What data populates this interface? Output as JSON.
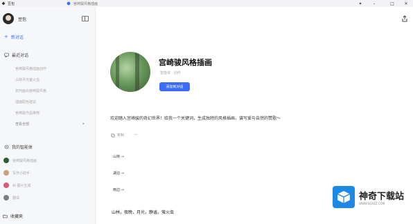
{
  "titlebar": {
    "app_title": "豆包",
    "tab_text": "宫崎骏风格插画"
  },
  "sidebar": {
    "user_name": "豆包",
    "new_chat": "新对话",
    "recent_header": "最近对话",
    "recent_items": [
      "宫崎骏风格插画创作",
      "山林月光萤火虫",
      "如何画出宫崎骏风格",
      "插画配色建议",
      "宫崎骏作品推荐"
    ],
    "more_label": "查看全部",
    "agents_header": "我的智能体",
    "agents": [
      {
        "label": "宫崎骏风格插画",
        "color": "#2f5d3a"
      },
      {
        "label": "写作小助手",
        "color": "#c9a27c"
      },
      {
        "label": "AI 图片生成",
        "color": "#d85c7a"
      },
      {
        "label": "翻译",
        "color": "#7d7d85"
      }
    ],
    "favorites": "收藏夹"
  },
  "bot": {
    "title": "宫崎骏风格插画",
    "meta": "智能体 · 创作",
    "add_button": "添加到对话"
  },
  "chat": {
    "welcome": "欢迎踏入宫崎骏的奇幻世界！给我一个关键词，生成独特的风格插画，谱写爱与自然的赞歌～",
    "action_label": "复制",
    "suggestions": [
      "山林 →",
      "湖泊 →",
      "雨边 →"
    ],
    "input_value": "山林，夜晚，月光，静谧，萤火虫"
  },
  "watermark": {
    "main": "神奇下载站",
    "url": "WWW.SQXZZ.COM"
  },
  "colors": {
    "accent": "#3b6cf6",
    "sidebar_bg": "#f6f7f9"
  }
}
